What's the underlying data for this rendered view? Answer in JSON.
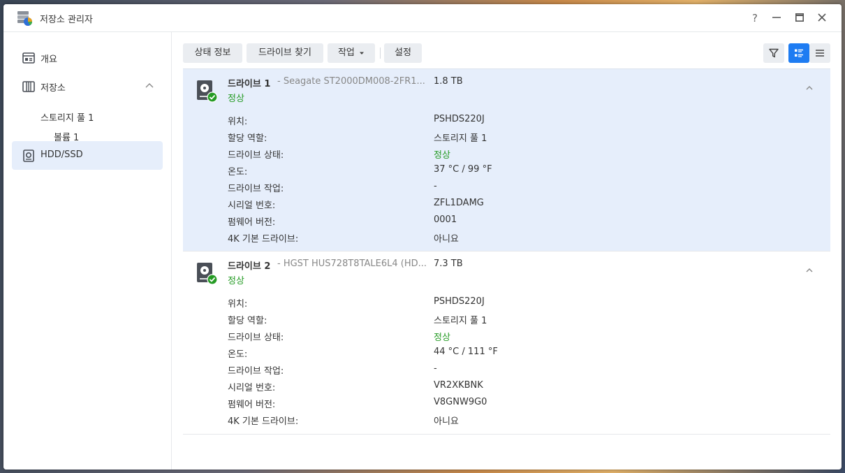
{
  "app": {
    "title": "저장소 관리자",
    "icon": "storage-manager-icon"
  },
  "window_controls": {
    "help": "?",
    "minimize": "—",
    "maximize": "□",
    "close": "✕"
  },
  "sidebar": {
    "items": [
      {
        "label": "개요",
        "icon": "overview-icon"
      },
      {
        "label": "저장소",
        "icon": "storage-icon"
      },
      {
        "label": "HDD/SSD",
        "icon": "hdd-icon"
      }
    ],
    "sub_items": [
      {
        "label": "스토리지 풀 1"
      },
      {
        "label": "볼륨 1"
      }
    ]
  },
  "toolbar": {
    "status_info": "상태 정보",
    "find_drive": "드라이브 찾기",
    "action": "작업",
    "settings": "설정"
  },
  "drives": [
    {
      "name": "드라이브 1",
      "model": "- Seagate ST2000DM008-2FR1...",
      "size": "1.8 TB",
      "status": "정상",
      "details": [
        {
          "label": "위치:",
          "value": "PSHDS220J"
        },
        {
          "label": "할당 역할:",
          "value": "스토리지 풀 1"
        },
        {
          "label": "드라이브 상태:",
          "value": "정상"
        },
        {
          "label": "온도:",
          "value": "37 °C / 99 °F"
        },
        {
          "label": "드라이브 작업:",
          "value": "-"
        },
        {
          "label": "시리얼 번호:",
          "value": "ZFL1DAMG"
        },
        {
          "label": "펌웨어 버전:",
          "value": "0001"
        },
        {
          "label": "4K 기본 드라이브:",
          "value": "아니요"
        }
      ]
    },
    {
      "name": "드라이브 2",
      "model": "- HGST HUS728T8TALE6L4 (HD...",
      "size": "7.3 TB",
      "status": "정상",
      "details": [
        {
          "label": "위치:",
          "value": "PSHDS220J"
        },
        {
          "label": "할당 역할:",
          "value": "스토리지 풀 1"
        },
        {
          "label": "드라이브 상태:",
          "value": "정상"
        },
        {
          "label": "온도:",
          "value": "44 °C / 111 °F"
        },
        {
          "label": "드라이브 작업:",
          "value": "-"
        },
        {
          "label": "시리얼 번호:",
          "value": "VR2XKBNK"
        },
        {
          "label": "펌웨어 버전:",
          "value": "V8GNW9G0"
        },
        {
          "label": "4K 기본 드라이브:",
          "value": "아니요"
        }
      ]
    }
  ],
  "colors": {
    "accent": "#1e7cf2",
    "ok": "#259b24",
    "selected_bg": "#e6eefb"
  }
}
